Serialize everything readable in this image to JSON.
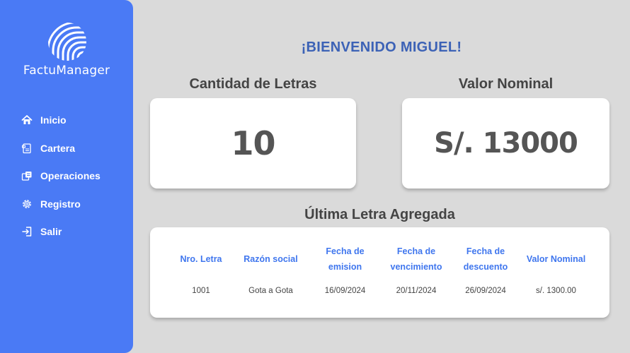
{
  "app": {
    "brand_name": "FactuManager",
    "accent_color": "#4a7af5",
    "logo_icon": "fingerprint-logo"
  },
  "sidebar": {
    "items": [
      {
        "label": "Inicio",
        "icon": "home-icon"
      },
      {
        "label": "Cartera",
        "icon": "wallet-icon"
      },
      {
        "label": "Operaciones",
        "icon": "operations-icon"
      },
      {
        "label": "Registro",
        "icon": "settings-icon"
      },
      {
        "label": "Salir",
        "icon": "logout-icon"
      }
    ]
  },
  "main": {
    "welcome": "¡BIENVENIDO MIGUEL!",
    "cards": {
      "count": {
        "title": "Cantidad de Letras",
        "value": "10"
      },
      "nominal": {
        "title": "Valor Nominal",
        "value": "S/. 13000"
      }
    },
    "last_letter": {
      "title": "Última Letra Agregada",
      "headers": [
        "Nro. Letra",
        "Razón social",
        "Fecha de emision",
        "Fecha de vencimiento",
        "Fecha de descuento",
        "Valor Nominal"
      ],
      "row": [
        "1001",
        "Gota a Gota",
        "16/09/2024",
        "20/11/2024",
        "26/09/2024",
        "s/. 1300.00"
      ]
    }
  }
}
